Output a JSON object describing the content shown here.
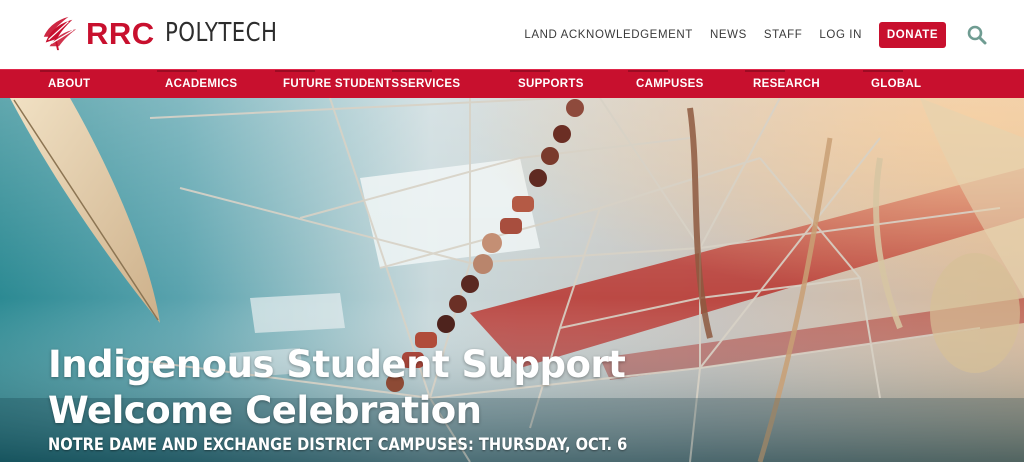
{
  "brand": {
    "name_primary": "RRC",
    "name_secondary": "POLYTECH",
    "logo_icon": "rrc-feather-logo-icon",
    "accent_color": "#c8102e"
  },
  "utility_nav": {
    "links": [
      "LAND ACKNOWLEDGEMENT",
      "NEWS",
      "STAFF",
      "LOG IN"
    ],
    "donate_label": "DONATE",
    "search_icon": "search-icon"
  },
  "main_nav": {
    "items": [
      "ABOUT",
      "ACADEMICS",
      "FUTURE STUDENTS",
      "SERVICES",
      "SUPPORTS",
      "CAMPUSES",
      "RESEARCH",
      "GLOBAL"
    ]
  },
  "hero": {
    "title_line1": "Indigenous Student Support",
    "title_line2": "Welcome Celebration",
    "subtitle": "NOTRE DAME AND EXCHANGE DISTRICT CAMPUSES: THURSDAY, OCT. 6",
    "image": "dreamcatcher-with-beads-and-feather"
  }
}
